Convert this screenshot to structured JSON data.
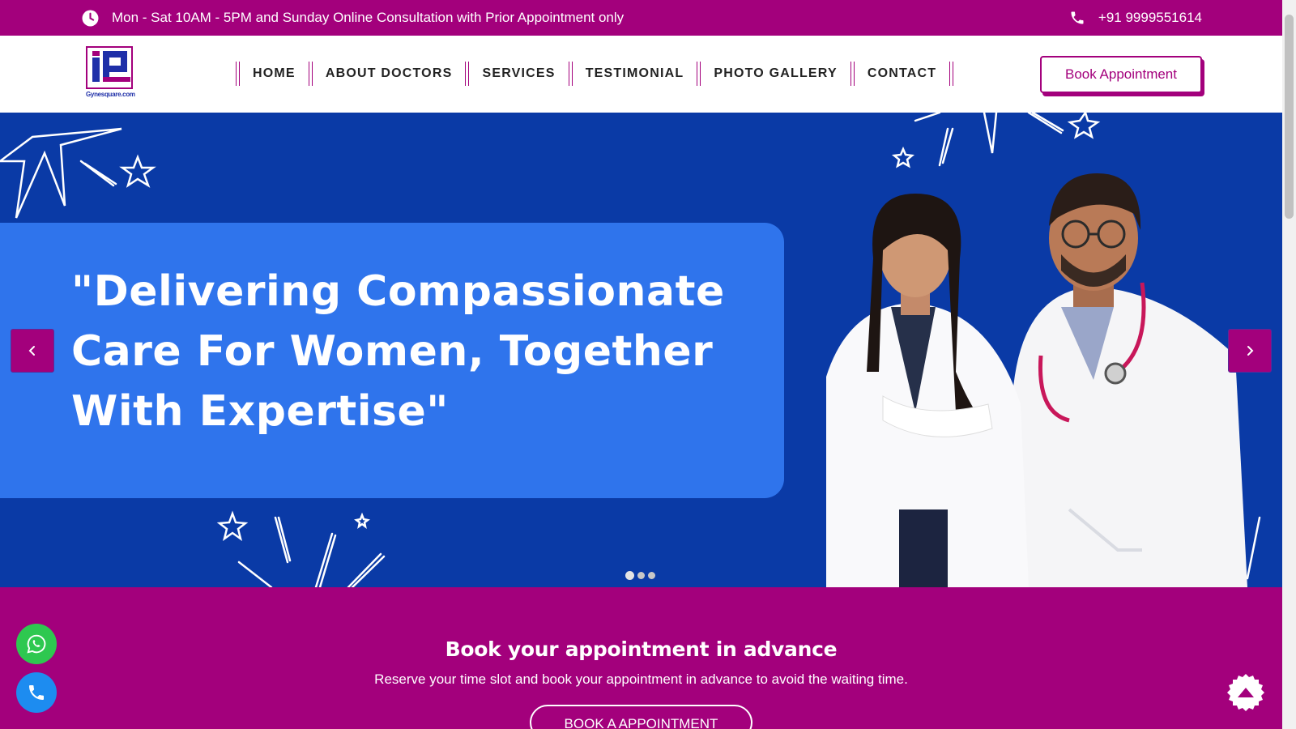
{
  "topbar": {
    "hours_text": "Mon - Sat 10AM - 5PM and Sunday Online Consultation with Prior Appointment only",
    "hours_icon": "clock-icon",
    "phone": "+91 9999551614",
    "phone_icon": "phone-icon",
    "bg_color": "#a3007c"
  },
  "header": {
    "logo_caption": "Gynesquare.com",
    "nav": {
      "home": "HOME",
      "about": "ABOUT DOCTORS",
      "services": "SERVICES",
      "testimonial": "TESTIMONIAL",
      "gallery": "PHOTO GALLERY",
      "contact": "CONTACT"
    },
    "book_label": "Book Appointment"
  },
  "hero": {
    "quote": "\"Delivering Compassionate Care For Women, Together With Expertise\"",
    "prev_icon": "chevron-left-icon",
    "next_icon": "chevron-right-icon",
    "slide_count": 3,
    "active_slide": 1,
    "bg_color": "#0a3aa6",
    "box_color": "#2f74ec"
  },
  "appointment": {
    "title": "Book your appointment in advance",
    "subtitle": "Reserve your time slot and book your appointment in advance to avoid the waiting time.",
    "cta": "BOOK A APPOINTMENT"
  },
  "floating": {
    "whatsapp_icon": "whatsapp-icon",
    "call_icon": "phone-icon",
    "scroll_top_icon": "arrow-up-icon"
  }
}
